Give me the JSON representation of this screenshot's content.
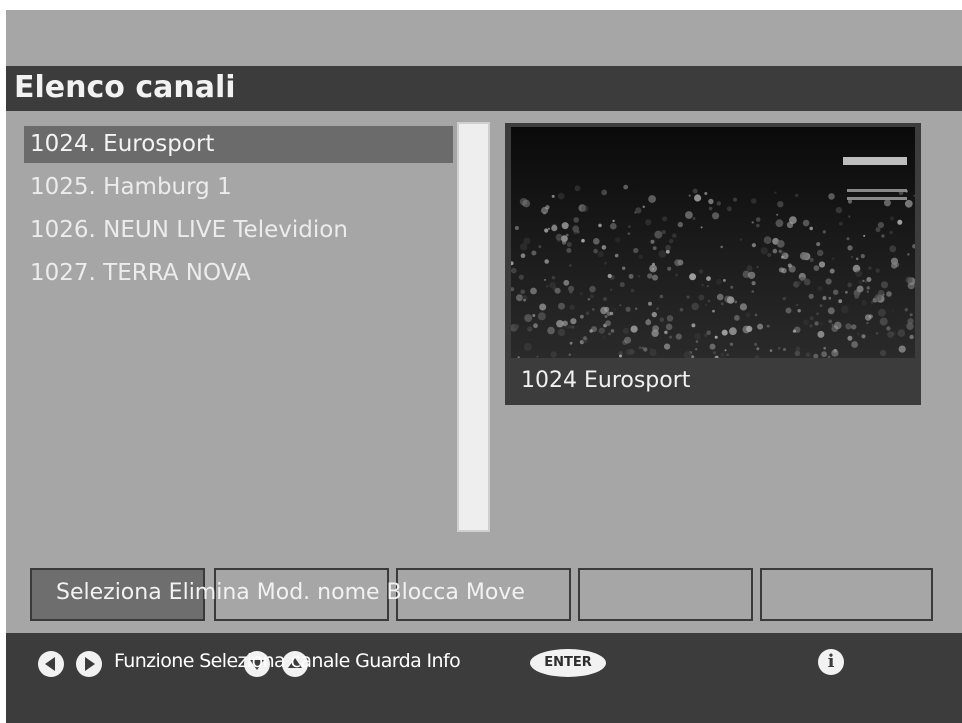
{
  "header": {
    "title": "Elenco canali"
  },
  "channels": [
    {
      "label": "1024. Eurosport",
      "selected": true
    },
    {
      "label": "1025. Hamburg 1",
      "selected": false
    },
    {
      "label": "1026. NEUN LIVE Televidion",
      "selected": false
    },
    {
      "label": "1027. TERRA NOVA",
      "selected": false
    }
  ],
  "preview": {
    "label": "1024 Eurosport"
  },
  "function_bar": {
    "labels": "Seleziona Elimina Mod. nome Blocca Move"
  },
  "footer": {
    "hint": "Funzione Seleziona canale Guarda Info",
    "enter_label": "ENTER",
    "info_label": "i",
    "icons": [
      "left-arrow-icon",
      "right-arrow-icon",
      "down-arrow-icon",
      "up-arrow-icon",
      "enter-icon",
      "info-icon"
    ]
  },
  "colors": {
    "background": "#a6a6a6",
    "bar": "#3c3c3c",
    "selected_row": "#6b6b6b",
    "text": "#f2f2f2"
  }
}
